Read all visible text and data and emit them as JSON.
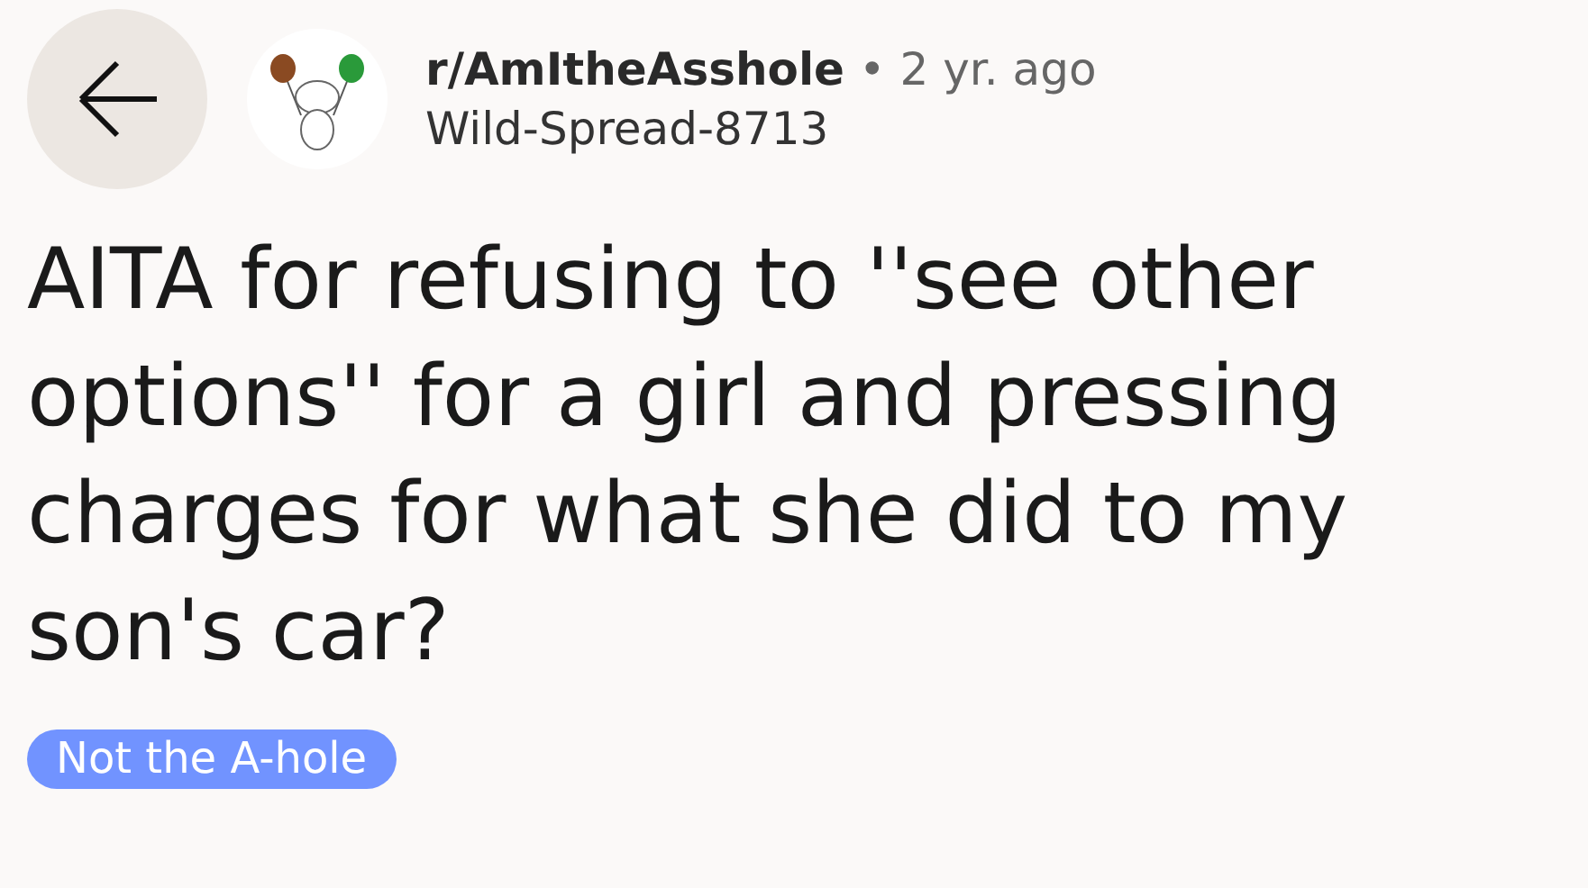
{
  "post": {
    "subreddit": "r/AmItheAsshole",
    "separator": "•",
    "time": "2 yr. ago",
    "author": "Wild-Spread-8713",
    "title": "AITA for refusing to ''see other options'' for a girl and pressing charges for what she did to my son's car?",
    "flair": {
      "label": "Not the A-hole",
      "color": "#7193ff"
    }
  }
}
